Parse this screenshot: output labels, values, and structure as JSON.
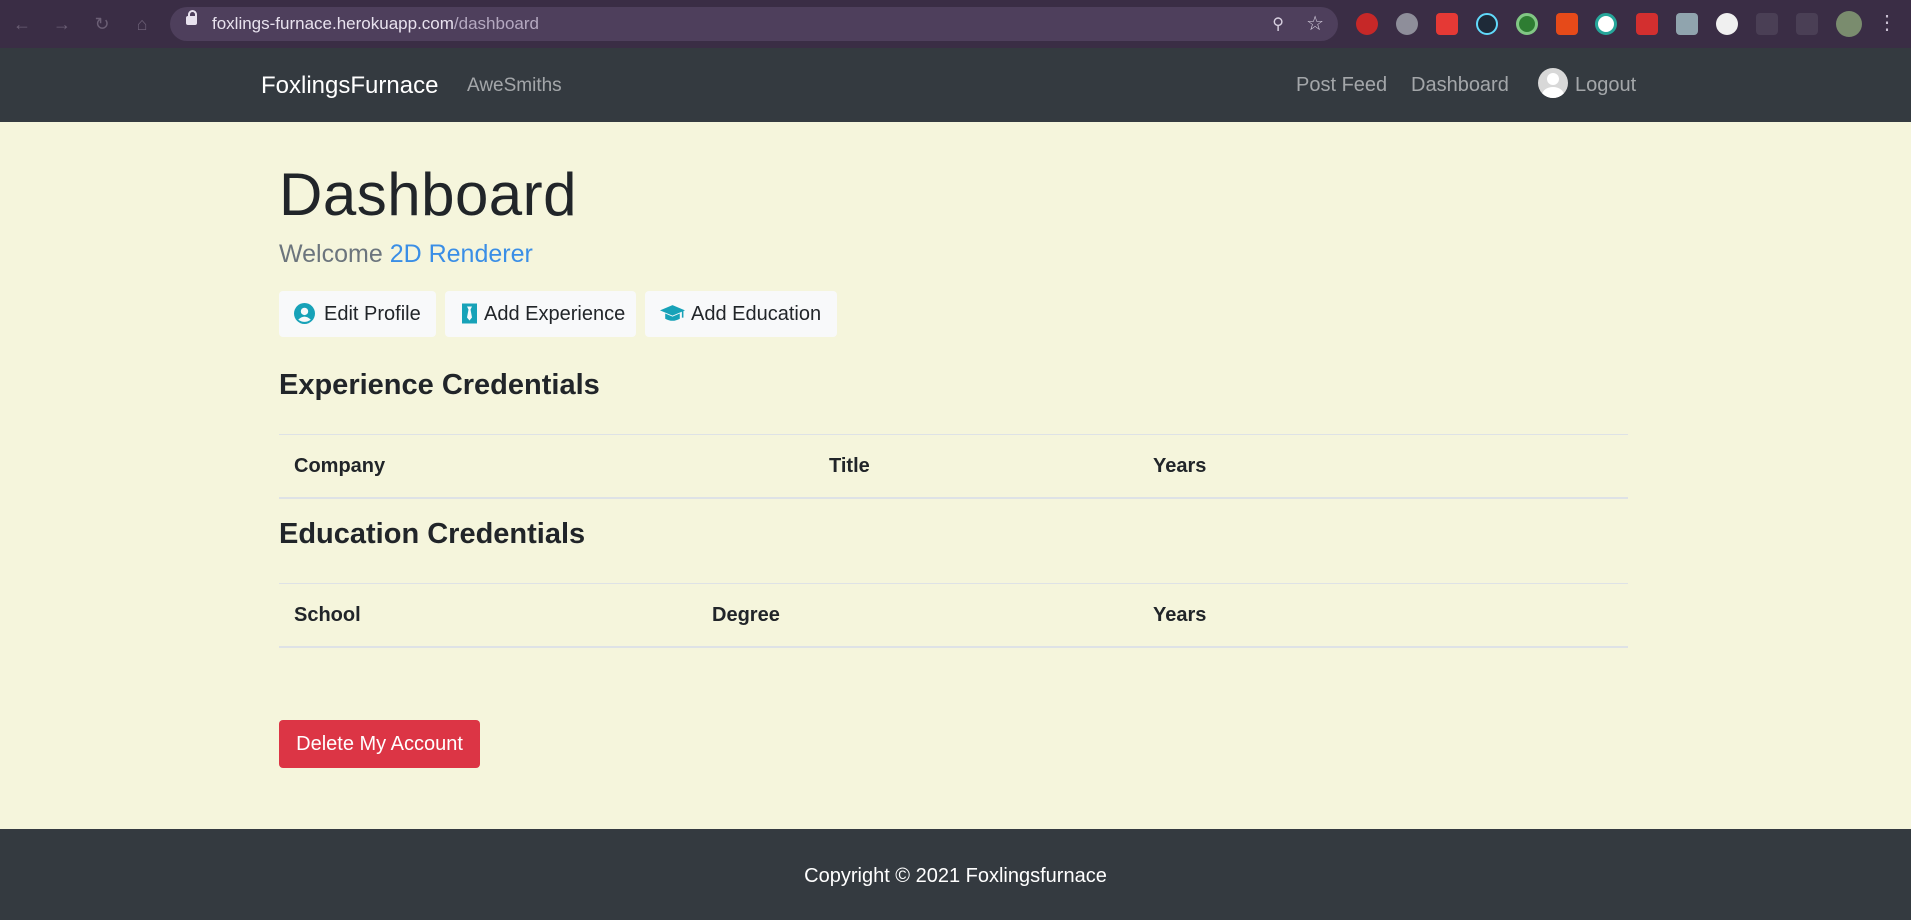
{
  "browser": {
    "url_host": "foxlings-furnace.herokuapp.com",
    "url_path": "/dashboard",
    "colors": {
      "frame": "#3a2d45",
      "omnibox": "#4e3f5c"
    }
  },
  "navbar": {
    "brand": "FoxlingsFurnace",
    "secondary": "AweSmiths",
    "links": {
      "post_feed": "Post Feed",
      "dashboard": "Dashboard",
      "logout": "Logout"
    }
  },
  "page": {
    "title": "Dashboard",
    "welcome_prefix": "Welcome ",
    "user_name": "2D Renderer",
    "actions": {
      "edit_profile": "Edit Profile",
      "add_experience": "Add Experience",
      "add_education": "Add Education"
    },
    "experience": {
      "heading": "Experience Credentials",
      "columns": [
        "Company",
        "Title",
        "Years"
      ]
    },
    "education": {
      "heading": "Education Credentials",
      "columns": [
        "School",
        "Degree",
        "Years"
      ]
    },
    "delete_label": "Delete My Account"
  },
  "footer": {
    "copyright": "Copyright © 2021 Foxlingsfurnace"
  },
  "colors": {
    "background": "#f5f5dc",
    "navbar": "#343a40",
    "accent_icon": "#17a2b8",
    "link_blue": "#3a8ee6",
    "danger": "#dc3545"
  }
}
